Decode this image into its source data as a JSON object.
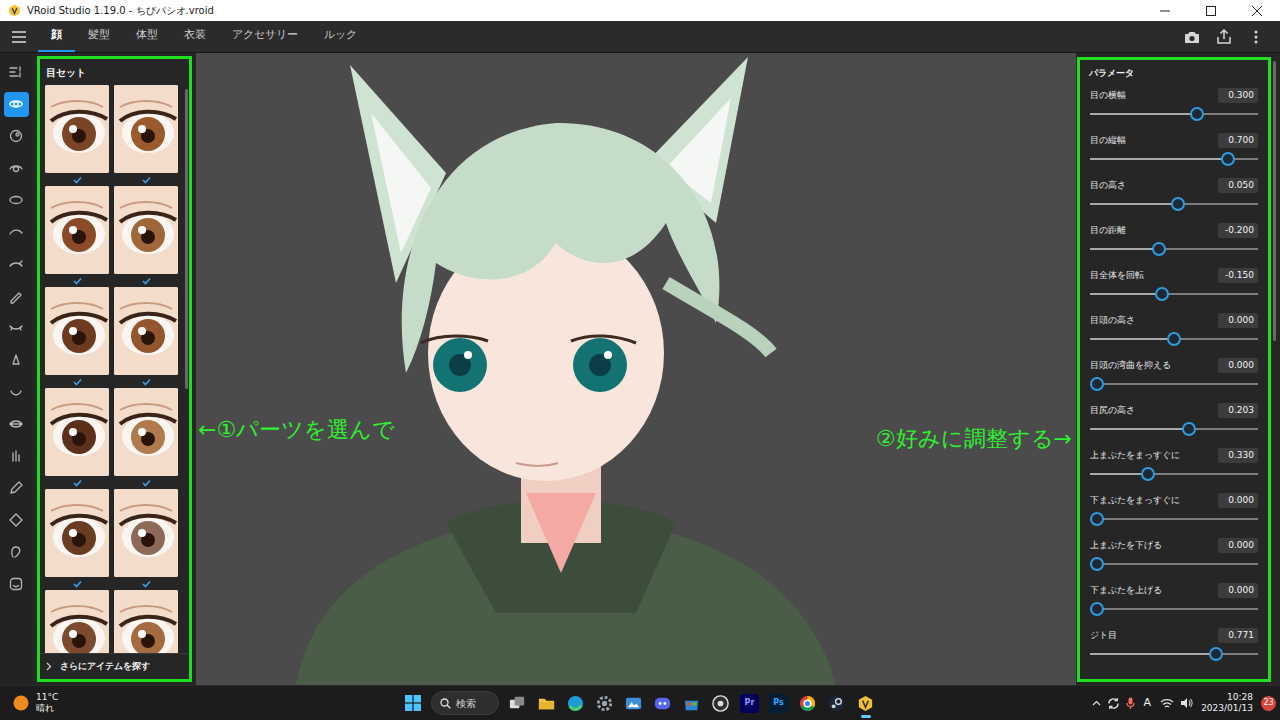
{
  "window": {
    "title": "VRoid Studio 1.19.0 - ちびパシオ.vroid"
  },
  "tabs": [
    {
      "label": "顔",
      "selected": true
    },
    {
      "label": "髪型",
      "selected": false
    },
    {
      "label": "体型",
      "selected": false
    },
    {
      "label": "衣装",
      "selected": false
    },
    {
      "label": "アクセサリー",
      "selected": false
    },
    {
      "label": "ルック",
      "selected": false
    }
  ],
  "rail": [
    {
      "selected": false
    },
    {
      "selected": true
    },
    {
      "selected": false
    },
    {
      "selected": false
    },
    {
      "selected": false
    },
    {
      "selected": false
    },
    {
      "selected": false
    },
    {
      "selected": false
    },
    {
      "selected": false
    },
    {
      "selected": false
    },
    {
      "selected": false
    },
    {
      "selected": false
    },
    {
      "selected": false
    },
    {
      "selected": false
    },
    {
      "selected": false
    },
    {
      "selected": false
    },
    {
      "selected": false
    }
  ],
  "eye_panel": {
    "title": "目セット",
    "thumbnails": [
      {
        "checked": true
      },
      {
        "checked": true
      },
      {
        "checked": true
      },
      {
        "checked": true
      },
      {
        "checked": true
      },
      {
        "checked": true
      },
      {
        "checked": true
      },
      {
        "checked": true
      },
      {
        "checked": true
      },
      {
        "checked": true
      },
      {
        "checked": false
      },
      {
        "checked": false
      }
    ],
    "more": "さらにアイテムを探す"
  },
  "viewport": {
    "annotations": [
      "←①パーツを選んで",
      "②好みに調整する→"
    ]
  },
  "parameters": {
    "title": "パラメータ",
    "sliders": [
      {
        "label": "目の横幅",
        "reading": "0.300",
        "level": 0.65
      },
      {
        "label": "目の縦幅",
        "reading": "0.700",
        "level": 0.85
      },
      {
        "label": "目の高さ",
        "reading": "0.050",
        "level": 0.525
      },
      {
        "label": "目の距離",
        "reading": "-0.200",
        "level": 0.4
      },
      {
        "label": "目全体を回転",
        "reading": "-0.150",
        "level": 0.425
      },
      {
        "label": "目頭の高さ",
        "reading": "0.000",
        "level": 0.5
      },
      {
        "label": "目頭の湾曲を抑える",
        "reading": "0.000",
        "level": 0
      },
      {
        "label": "目尻の高さ",
        "reading": "0.203",
        "level": 0.6
      },
      {
        "label": "上まぶたをまっすぐに",
        "reading": "0.330",
        "level": 0.33
      },
      {
        "label": "下まぶたをまっすぐに",
        "reading": "0.000",
        "level": 0
      },
      {
        "label": "上まぶたを下げる",
        "reading": "0.000",
        "level": 0
      },
      {
        "label": "下まぶたを上げる",
        "reading": "0.000",
        "level": 0
      },
      {
        "label": "ジト目",
        "reading": "0.771",
        "level": 0.771
      }
    ]
  },
  "taskbar": {
    "weather": {
      "temperature": "11°C",
      "condition": "晴れ"
    },
    "search": "検索",
    "apps": [
      {
        "kind": "icon",
        "selected": false
      },
      {
        "kind": "icon",
        "selected": false
      },
      {
        "kind": "icon",
        "selected": false
      },
      {
        "kind": "icon",
        "selected": false
      },
      {
        "kind": "icon",
        "selected": false
      },
      {
        "kind": "icon",
        "selected": false
      },
      {
        "kind": "icon",
        "selected": false
      },
      {
        "kind": "icon",
        "selected": false
      },
      {
        "kind": "label",
        "text": "Pr",
        "selected": false
      },
      {
        "kind": "label",
        "text": "Ps",
        "selected": false
      },
      {
        "kind": "icon",
        "selected": false
      },
      {
        "kind": "icon",
        "selected": false
      },
      {
        "kind": "icon",
        "selected": true
      }
    ],
    "tray": {
      "ime": "A",
      "time": "10:28",
      "date": "2023/01/13",
      "badge": "23"
    }
  }
}
